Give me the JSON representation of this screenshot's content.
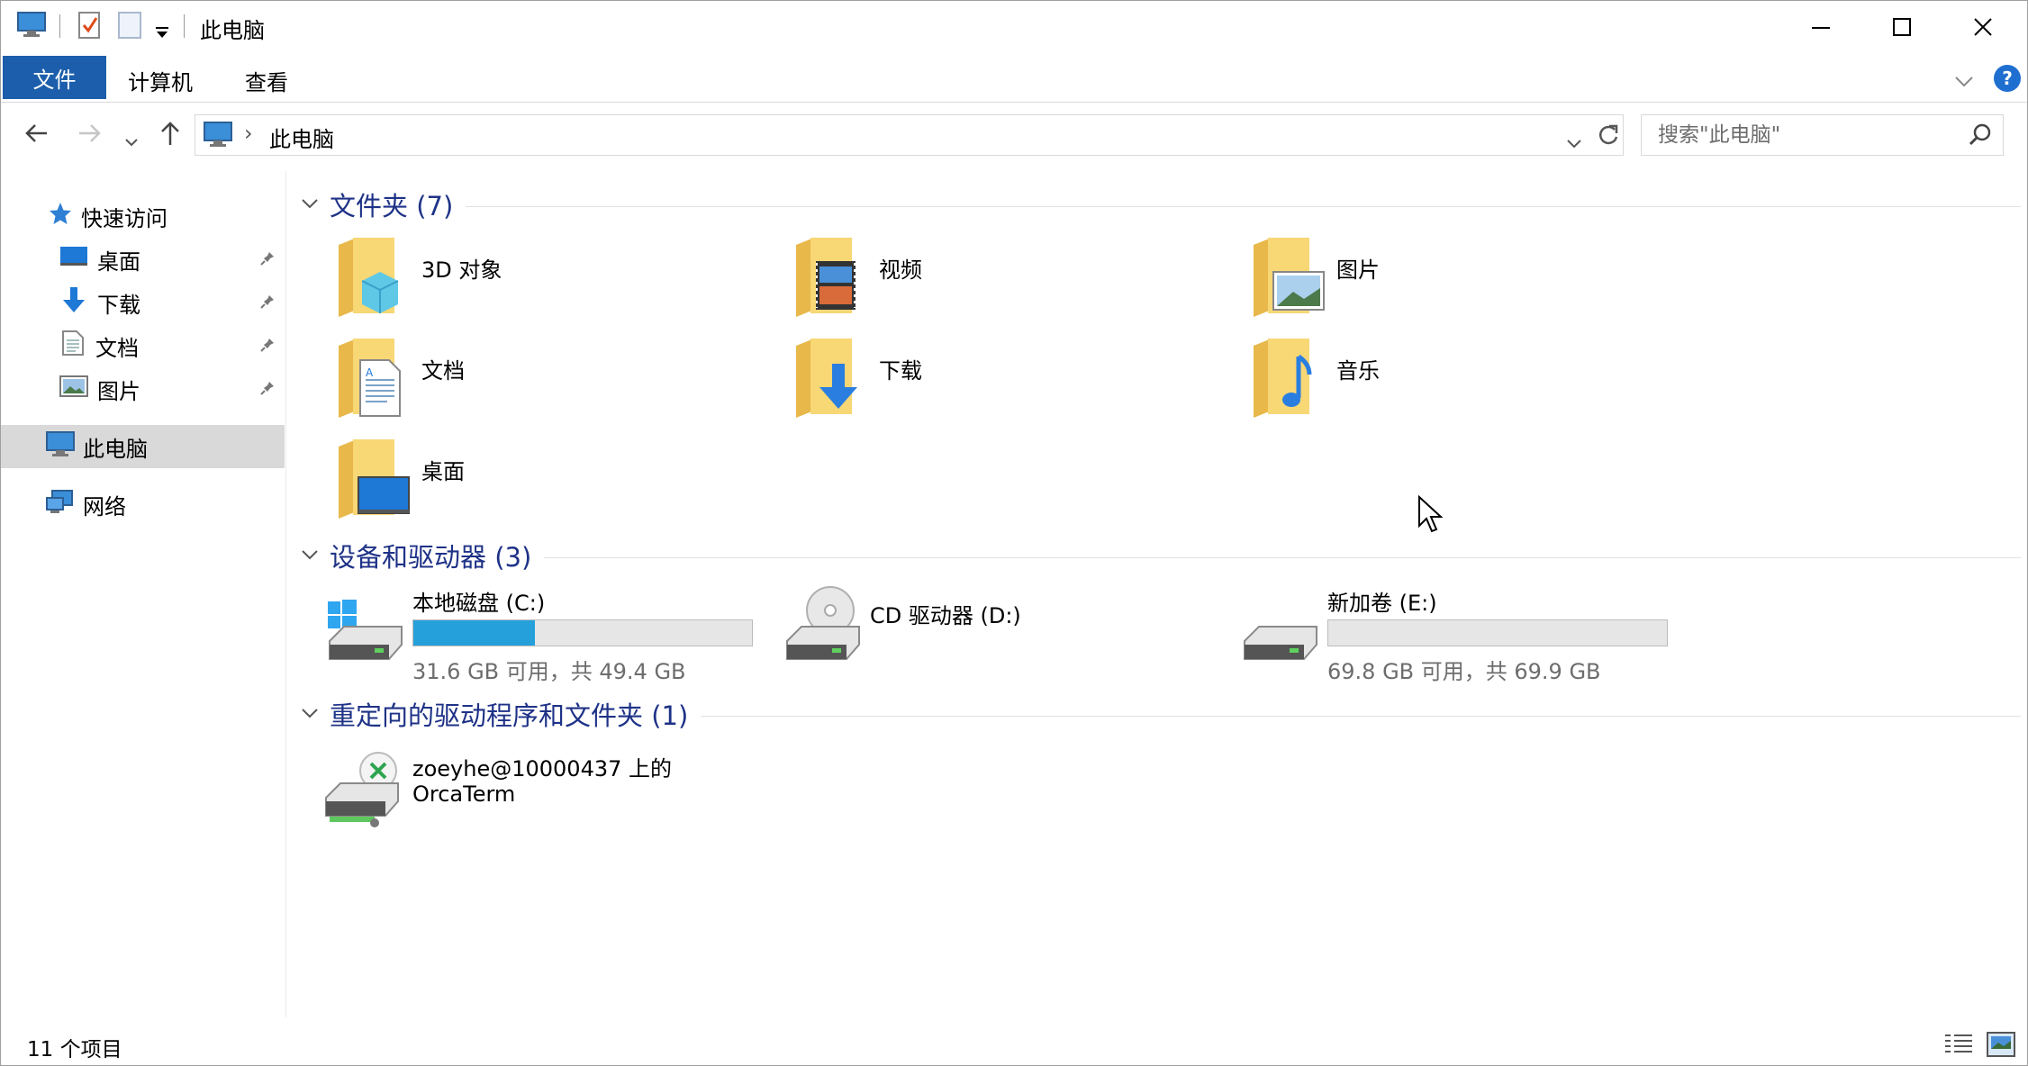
{
  "window": {
    "title": "此电脑",
    "icons": {
      "app": "computer-icon",
      "properties": "properties-checkmark-icon",
      "new_folder": "new-folder-icon",
      "customize": "dropdown-arrow-icon"
    },
    "controls": {
      "minimize": "minimize-icon",
      "maximize": "maximize-icon",
      "close": "close-icon"
    }
  },
  "ribbon": {
    "tabs": [
      "文件",
      "计算机",
      "查看"
    ],
    "active_tab": "文件",
    "accent": "#1c5eab",
    "help": "?"
  },
  "address_bar": {
    "path": "此电脑",
    "separator": "›",
    "search_placeholder": "搜索\"此电脑\""
  },
  "sidebar": {
    "quick_access": {
      "label": "快速访问",
      "icon": "star-icon"
    },
    "pinned": [
      {
        "label": "桌面",
        "icon": "desktop-icon"
      },
      {
        "label": "下载",
        "icon": "download-arrow-icon"
      },
      {
        "label": "文档",
        "icon": "document-icon"
      },
      {
        "label": "图片",
        "icon": "pictures-icon"
      }
    ],
    "this_pc": {
      "label": "此电脑",
      "icon": "computer-icon",
      "selected": true
    },
    "network": {
      "label": "网络",
      "icon": "network-icon"
    }
  },
  "groups": {
    "folders": {
      "title": "文件夹 (7)",
      "items": [
        {
          "label": "3D 对象",
          "icon": "3d-objects-folder-icon"
        },
        {
          "label": "视频",
          "icon": "videos-folder-icon"
        },
        {
          "label": "图片",
          "icon": "pictures-folder-icon"
        },
        {
          "label": "文档",
          "icon": "documents-folder-icon"
        },
        {
          "label": "下载",
          "icon": "downloads-folder-icon"
        },
        {
          "label": "音乐",
          "icon": "music-folder-icon"
        },
        {
          "label": "桌面",
          "icon": "desktop-folder-icon"
        }
      ]
    },
    "drives": {
      "title": "设备和驱动器 (3)",
      "items": [
        {
          "label": "本地磁盘 (C:)",
          "free": "31.6 GB 可用，共 49.4 GB",
          "used_fraction": 0.36,
          "icon": "windows-drive-icon"
        },
        {
          "label": "CD 驱动器 (D:)",
          "icon": "cd-drive-icon"
        },
        {
          "label": "新加卷 (E:)",
          "free": "69.8 GB 可用，共 69.9 GB",
          "used_fraction": 0.0,
          "icon": "hard-drive-icon"
        }
      ],
      "bar_color": "#26a0da"
    },
    "redirected": {
      "title": "重定向的驱动程序和文件夹 (1)",
      "items": [
        {
          "line1": "zoeyhe@10000437 上的",
          "line2": "OrcaTerm",
          "icon": "network-drive-icon"
        }
      ]
    }
  },
  "status": {
    "count": "11 个项目",
    "views": [
      "details-view-icon",
      "large-icons-view-icon"
    ]
  }
}
